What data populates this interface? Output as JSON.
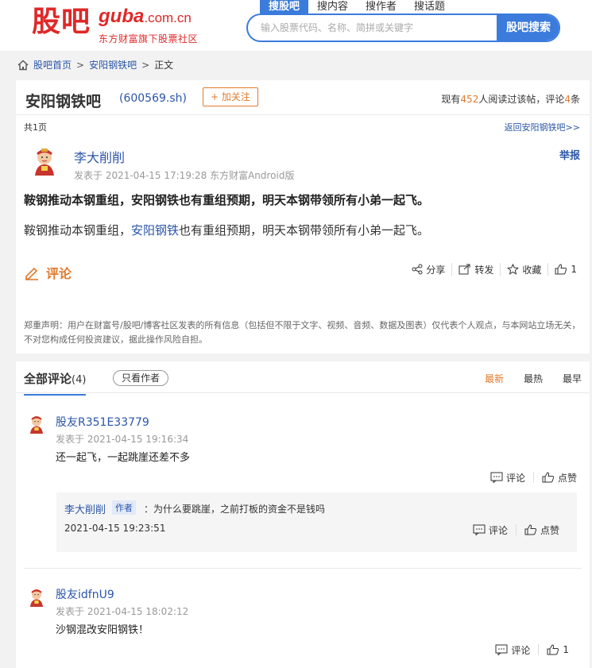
{
  "header": {
    "logo_cn": "股吧",
    "logo_domain_main": "guba",
    "logo_domain_suffix": ".com.cn",
    "slogan": "东方财富旗下股票社区",
    "tabs": [
      {
        "label": "搜股吧"
      },
      {
        "label": "搜内容"
      },
      {
        "label": "搜作者"
      },
      {
        "label": "搜话题"
      }
    ],
    "search_placeholder": "输入股票代码、名称、简拼或关键字",
    "search_button": "股吧搜索"
  },
  "breadcrumb": {
    "home": "股吧首页",
    "bar": "安阳钢铁吧",
    "current": "正文",
    "separator": ">"
  },
  "bar": {
    "name": "安阳钢铁吧",
    "code": "(600569.sh)",
    "follow": "+ 加关注",
    "stats_prefix": "现有",
    "read_count": "452",
    "stats_middle": "人阅读过该帖，评论",
    "comment_count": "4",
    "stats_suffix": "条",
    "page_info": "共1页",
    "back_link": "返回安阳钢铁吧>>"
  },
  "post": {
    "author": "李大削削",
    "meta": "发表于 2021-04-15 17:19:28 东方财富Android版",
    "report": "举报",
    "title": "鞍钢推动本钢重组，安阳钢铁也有重组预期，明天本钢带领所有小弟一起飞。",
    "body_before": "鞍钢推动本钢重组，",
    "body_link": "安阳钢铁",
    "body_after": "也有重组预期，明天本钢带领所有小弟一起飞。",
    "comment_label": "评论",
    "share": "分享",
    "forward": "转发",
    "favorite": "收藏",
    "like_count": "1",
    "disclaimer": "郑重声明：用户在财富号/股吧/博客社区发表的所有信息（包括但不限于文字、视频、音频、数据及图表）仅代表个人观点，与本网站立场无关，不对您构成任何投资建议，据此操作风险自担。"
  },
  "comments": {
    "title": "全部评论",
    "count": "(4)",
    "only_author": "只看作者",
    "sort": [
      "最新",
      "最热",
      "最早"
    ],
    "items": [
      {
        "user": "股友R351E33779",
        "time": "发表于 2021-04-15 19:16:34",
        "text": "还一起飞，一起跳崖还差不多",
        "comment": "评论",
        "like": "点赞",
        "reply": {
          "user": "李大削削",
          "badge": "作者",
          "text": "：为什么要跳崖，之前打板的资金不是钱吗",
          "time": "2021-04-15 19:23:51",
          "comment": "评论",
          "like": "点赞"
        }
      },
      {
        "user": "股友idfnU9",
        "time": "发表于 2021-04-15 18:02:12",
        "text": "沙钢混改安阳钢铁！",
        "comment": "评论",
        "like": "1"
      }
    ]
  },
  "colors": {
    "brand_red": "#e02828",
    "link_blue": "#2a55a8",
    "accent_orange": "#e07b2e",
    "search_blue": "#3a7bdc"
  }
}
